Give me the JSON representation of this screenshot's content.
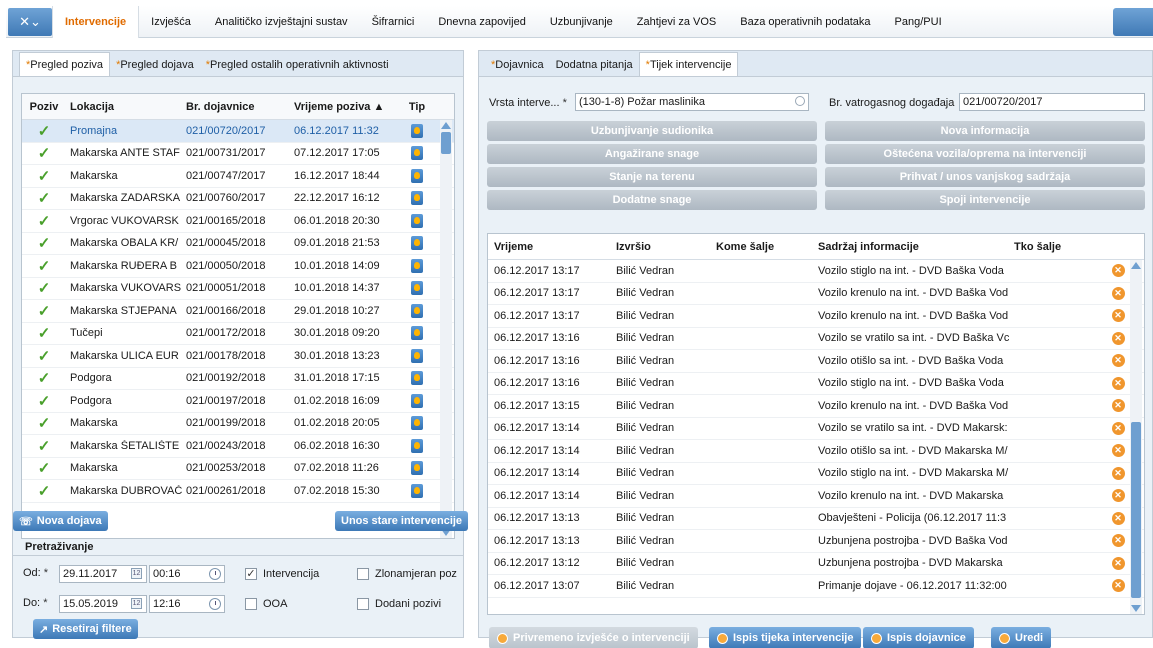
{
  "menubar": {
    "app_icon": "wrench-icon",
    "items": [
      {
        "label": "Intervencije",
        "active": true
      },
      {
        "label": "Izvješća"
      },
      {
        "label": "Analitičko izvještajni sustav"
      },
      {
        "label": "Šifrarnici"
      },
      {
        "label": "Dnevna zapovijed"
      },
      {
        "label": "Uzbunjivanje"
      },
      {
        "label": "Zahtjevi za VOS"
      },
      {
        "label": "Baza operativnih podataka"
      },
      {
        "label": "Pang/PUI"
      }
    ]
  },
  "left": {
    "subtabs": [
      {
        "star": "*",
        "label": "Pregled poziva",
        "active": true
      },
      {
        "star": "*",
        "label": "Pregled dojava"
      },
      {
        "star": "*",
        "label": "Pregled ostalih operativnih aktivnosti"
      }
    ],
    "columns": {
      "poziv": "Poziv",
      "lokacija": "Lokacija",
      "br": "Br. dojavnice",
      "vrijeme": "Vrijeme poziva ▲",
      "tip": "Tip"
    },
    "rows": [
      {
        "lokacija": "Promajna",
        "br": "021/00720/2017",
        "vrijeme": "06.12.2017 11:32"
      },
      {
        "lokacija": "Makarska ANTE STAF",
        "br": "021/00731/2017",
        "vrijeme": "07.12.2017 17:05"
      },
      {
        "lokacija": "Makarska",
        "br": "021/00747/2017",
        "vrijeme": "16.12.2017 18:44"
      },
      {
        "lokacija": "Makarska ZADARSKA",
        "br": "021/00760/2017",
        "vrijeme": "22.12.2017 16:12"
      },
      {
        "lokacija": "Vrgorac VUKOVARSK",
        "br": "021/00165/2018",
        "vrijeme": "06.01.2018 20:30"
      },
      {
        "lokacija": "Makarska OBALA KR/",
        "br": "021/00045/2018",
        "vrijeme": "09.01.2018 21:53"
      },
      {
        "lokacija": "Makarska RUĐERA B",
        "br": "021/00050/2018",
        "vrijeme": "10.01.2018 14:09"
      },
      {
        "lokacija": "Makarska VUKOVARS",
        "br": "021/00051/2018",
        "vrijeme": "10.01.2018 14:37"
      },
      {
        "lokacija": "Makarska STJEPANA",
        "br": "021/00166/2018",
        "vrijeme": "29.01.2018 10:27"
      },
      {
        "lokacija": "Tučepi",
        "br": "021/00172/2018",
        "vrijeme": "30.01.2018 09:20"
      },
      {
        "lokacija": "Makarska ULICA EUR",
        "br": "021/00178/2018",
        "vrijeme": "30.01.2018 13:23"
      },
      {
        "lokacija": "Podgora",
        "br": "021/00192/2018",
        "vrijeme": "31.01.2018 17:15"
      },
      {
        "lokacija": "Podgora",
        "br": "021/00197/2018",
        "vrijeme": "01.02.2018 16:09"
      },
      {
        "lokacija": "Makarska",
        "br": "021/00199/2018",
        "vrijeme": "01.02.2018 20:05"
      },
      {
        "lokacija": "Makarska ŠETALIŠTE",
        "br": "021/00243/2018",
        "vrijeme": "06.02.2018 16:30"
      },
      {
        "lokacija": "Makarska",
        "br": "021/00253/2018",
        "vrijeme": "07.02.2018 11:26"
      },
      {
        "lokacija": "Makarska DUBROVAČ",
        "br": "021/00261/2018",
        "vrijeme": "07.02.2018 15:30"
      }
    ],
    "nova_dojava": "Nova dojava",
    "unos_stare": "Unos stare intervencije",
    "search_title": "Pretraživanje",
    "od_label": "Od:",
    "do_label": "Do:",
    "req": "*",
    "od_date": "29.11.2017",
    "od_time": "00:16",
    "do_date": "15.05.2019",
    "do_time": "12:16",
    "cal_glyph": "12",
    "cb_intervencija": "Intervencija",
    "cb_ooa": "OOA",
    "cb_zlonamjeran": "Zlonamjeran poz",
    "cb_dodani": "Dodani pozivi",
    "check_mark": "✓",
    "resetiraj": "Resetiraj filtere"
  },
  "right": {
    "subtabs": [
      {
        "star": "*",
        "label": "Dojavnica"
      },
      {
        "star": "",
        "label": "Dodatna pitanja"
      },
      {
        "star": "*",
        "label": "Tijek intervencije",
        "active": true
      }
    ],
    "vrsta_label": "Vrsta interve...",
    "vrsta_value": "(130-1-8) Požar maslinika",
    "br_vatro_label": "Br. vatrogasnog događaja",
    "br_vatro_value": "021/00720/2017",
    "buttons_left": [
      "Uzbunjivanje sudionika",
      "Angažirane snage",
      "Stanje na terenu",
      "Dodatne snage"
    ],
    "buttons_right": [
      "Nova informacija",
      "Oštećena vozila/oprema na intervenciji",
      "Prihvat / unos vanjskog sadržaja",
      "Spoji intervencije"
    ],
    "columns": {
      "vrijeme": "Vrijeme",
      "izvrsio": "Izvršio",
      "kome": "Kome šalje",
      "sadrzaj": "Sadržaj informacije",
      "tko": "Tko šalje"
    },
    "rows": [
      {
        "vrijeme": "06.12.2017 13:17",
        "izvrsio": "Bilić Vedran",
        "sadrzaj": "Vozilo stiglo na int. - DVD Baška Voda"
      },
      {
        "vrijeme": "06.12.2017 13:17",
        "izvrsio": "Bilić Vedran",
        "sadrzaj": "Vozilo krenulo na int. - DVD Baška Vod"
      },
      {
        "vrijeme": "06.12.2017 13:17",
        "izvrsio": "Bilić Vedran",
        "sadrzaj": "Vozilo krenulo na int. - DVD Baška Vod"
      },
      {
        "vrijeme": "06.12.2017 13:16",
        "izvrsio": "Bilić Vedran",
        "sadrzaj": "Vozilo se vratilo sa int. - DVD Baška Vc"
      },
      {
        "vrijeme": "06.12.2017 13:16",
        "izvrsio": "Bilić Vedran",
        "sadrzaj": "Vozilo otišlo sa int. - DVD Baška Voda"
      },
      {
        "vrijeme": "06.12.2017 13:16",
        "izvrsio": "Bilić Vedran",
        "sadrzaj": "Vozilo stiglo na int. - DVD Baška Voda"
      },
      {
        "vrijeme": "06.12.2017 13:15",
        "izvrsio": "Bilić Vedran",
        "sadrzaj": "Vozilo krenulo na int. - DVD Baška Vod"
      },
      {
        "vrijeme": "06.12.2017 13:14",
        "izvrsio": "Bilić Vedran",
        "sadrzaj": "Vozilo se vratilo sa int. - DVD Makarsk:"
      },
      {
        "vrijeme": "06.12.2017 13:14",
        "izvrsio": "Bilić Vedran",
        "sadrzaj": "Vozilo otišlo sa int. - DVD Makarska M/"
      },
      {
        "vrijeme": "06.12.2017 13:14",
        "izvrsio": "Bilić Vedran",
        "sadrzaj": "Vozilo stiglo na int. - DVD Makarska M/"
      },
      {
        "vrijeme": "06.12.2017 13:14",
        "izvrsio": "Bilić Vedran",
        "sadrzaj": "Vozilo krenulo na int. - DVD Makarska"
      },
      {
        "vrijeme": "06.12.2017 13:13",
        "izvrsio": "Bilić Vedran",
        "sadrzaj": "Obavješteni - Policija (06.12.2017 11:3"
      },
      {
        "vrijeme": "06.12.2017 13:13",
        "izvrsio": "Bilić Vedran",
        "sadrzaj": "Uzbunjena postrojba - DVD Baška Vod"
      },
      {
        "vrijeme": "06.12.2017 13:12",
        "izvrsio": "Bilić Vedran",
        "sadrzaj": "Uzbunjena postrojba - DVD Makarska"
      },
      {
        "vrijeme": "06.12.2017 13:07",
        "izvrsio": "Bilić Vedran",
        "sadrzaj": "Primanje dojave - 06.12.2017 11:32:00"
      }
    ],
    "x_glyph": "✕",
    "bottom_buttons": [
      {
        "label": "Privremeno izvješće o intervenciji",
        "disabled": true
      },
      {
        "label": "Ispis tijeka intervencije"
      },
      {
        "label": "Ispis dojavnice"
      },
      {
        "label": "Uredi"
      }
    ]
  }
}
